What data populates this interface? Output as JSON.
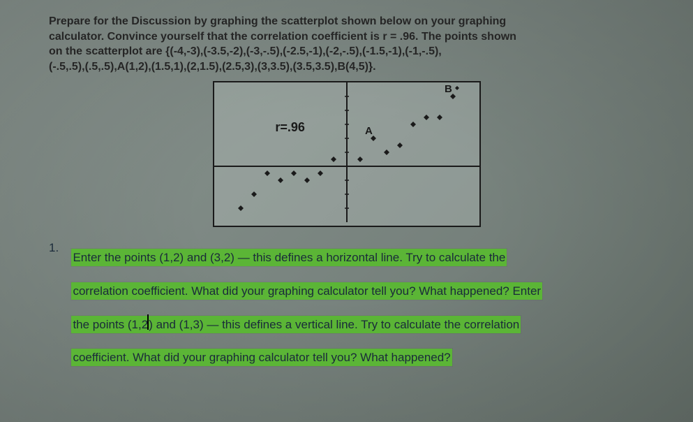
{
  "intro": {
    "line1": "Prepare for the Discussion by graphing the scatterplot shown below on your graphing",
    "line2": "calculator. Convince yourself that the correlation coefficient is r = .96. The points shown",
    "line3": "on the scatterplot are {(-4,-3),(-3.5,-2),(-3,-.5),(-2.5,-1),(-2,-.5),(-1.5,-1),(-1,-.5),",
    "line4": "(-.5,.5),(.5,.5),A(1,2),(1.5,1),(2,1.5),(2.5,3),(3,3.5),(3.5,3.5),B(4,5)}."
  },
  "chart_data": {
    "type": "scatter",
    "title": "",
    "xlabel": "",
    "ylabel": "",
    "xlim": [
      -5,
      5
    ],
    "ylim": [
      -4,
      6
    ],
    "r_label": "r=.96",
    "annotations": [
      {
        "text": "A",
        "x": 1,
        "y": 2
      },
      {
        "text": "B",
        "x": 4,
        "y": 5
      }
    ],
    "series": [
      {
        "name": "points",
        "points": [
          {
            "x": -4,
            "y": -3
          },
          {
            "x": -3.5,
            "y": -2
          },
          {
            "x": -3,
            "y": -0.5
          },
          {
            "x": -2.5,
            "y": -1
          },
          {
            "x": -2,
            "y": -0.5
          },
          {
            "x": -1.5,
            "y": -1
          },
          {
            "x": -1,
            "y": -0.5
          },
          {
            "x": -0.5,
            "y": 0.5
          },
          {
            "x": 0.5,
            "y": 0.5
          },
          {
            "x": 1,
            "y": 2
          },
          {
            "x": 1.5,
            "y": 1
          },
          {
            "x": 2,
            "y": 1.5
          },
          {
            "x": 2.5,
            "y": 3
          },
          {
            "x": 3,
            "y": 3.5
          },
          {
            "x": 3.5,
            "y": 3.5
          },
          {
            "x": 4,
            "y": 5
          }
        ]
      }
    ]
  },
  "question": {
    "number": "1.",
    "seg1": "Enter the points (1,2) and (3,2) — this defines a horizontal line. Try to calculate the",
    "seg2": "correlation coefficient. What did your graphing calculator tell you? What happened? Enter",
    "seg3a": "the points (1,2",
    "seg3b": " and (1,3) — this defines a vertical line. Try to calculate the correlation",
    "seg4": "coefficient. What did your graphing calculator tell you? What happened?"
  }
}
